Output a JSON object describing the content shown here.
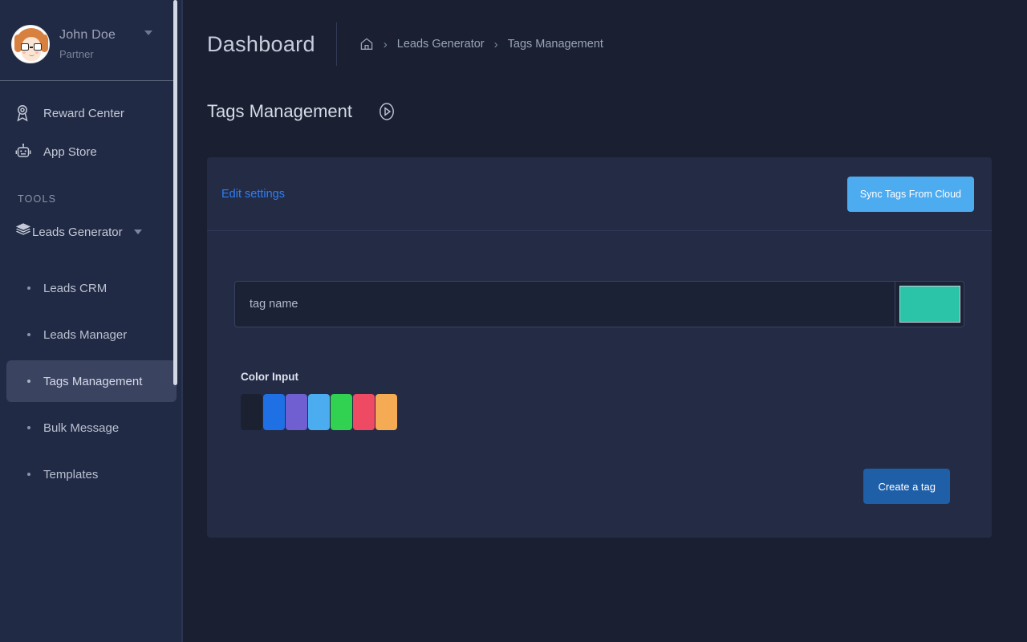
{
  "colors": {
    "page_bg": "#1a2032",
    "sidebar_bg": "#212a44",
    "card_bg": "#232b45",
    "accent_link": "#2d7ff9",
    "sync_button": "#4dabf0",
    "create_button": "#1f5fa8",
    "selected_swatch": "#2bc4a8",
    "active_item_bg": "#3a4360"
  },
  "sidebar": {
    "profile": {
      "name": "John Doe",
      "role": "Partner",
      "avatar_icon": "user-avatar-cartoon",
      "caret_icon": "chevron-down-icon"
    },
    "items": [
      {
        "label": "Reward Center",
        "icon": "award-medal-icon"
      },
      {
        "label": "App Store",
        "icon": "robot-icon"
      }
    ],
    "section_label": "TOOLS",
    "group": {
      "label": "Leads Generator",
      "icon": "layers-icon",
      "caret_icon": "chevron-down-icon",
      "expanded": true
    },
    "sub_items": [
      {
        "label": "Leads CRM",
        "active": false
      },
      {
        "label": "Leads Manager",
        "active": false
      },
      {
        "label": "Tags Management",
        "active": true
      },
      {
        "label": "Bulk Message",
        "active": false
      },
      {
        "label": "Templates",
        "active": false
      }
    ]
  },
  "topbar": {
    "title": "Dashboard",
    "breadcrumb": {
      "home_icon": "home-icon",
      "separator": "›",
      "items": [
        "Leads Generator",
        "Tags Management"
      ]
    }
  },
  "page": {
    "title": "Tags Management",
    "tutorial_icon": "play-circle-icon"
  },
  "card": {
    "edit_settings_label": "Edit settings",
    "sync_button_label": "Sync Tags From Cloud",
    "tag_name_placeholder": "tag name",
    "tag_name_value": "",
    "selected_color": "#2bc4a8",
    "color_input_label": "Color Input",
    "color_options": [
      {
        "name": "dark-navy",
        "hex": "#1b2130"
      },
      {
        "name": "blue",
        "hex": "#2070e5"
      },
      {
        "name": "purple",
        "hex": "#6f5fd0"
      },
      {
        "name": "light-blue",
        "hex": "#4badf0"
      },
      {
        "name": "green",
        "hex": "#31d152"
      },
      {
        "name": "pink",
        "hex": "#ef4a64"
      },
      {
        "name": "orange",
        "hex": "#f5ab54"
      }
    ],
    "create_button_label": "Create a tag"
  }
}
